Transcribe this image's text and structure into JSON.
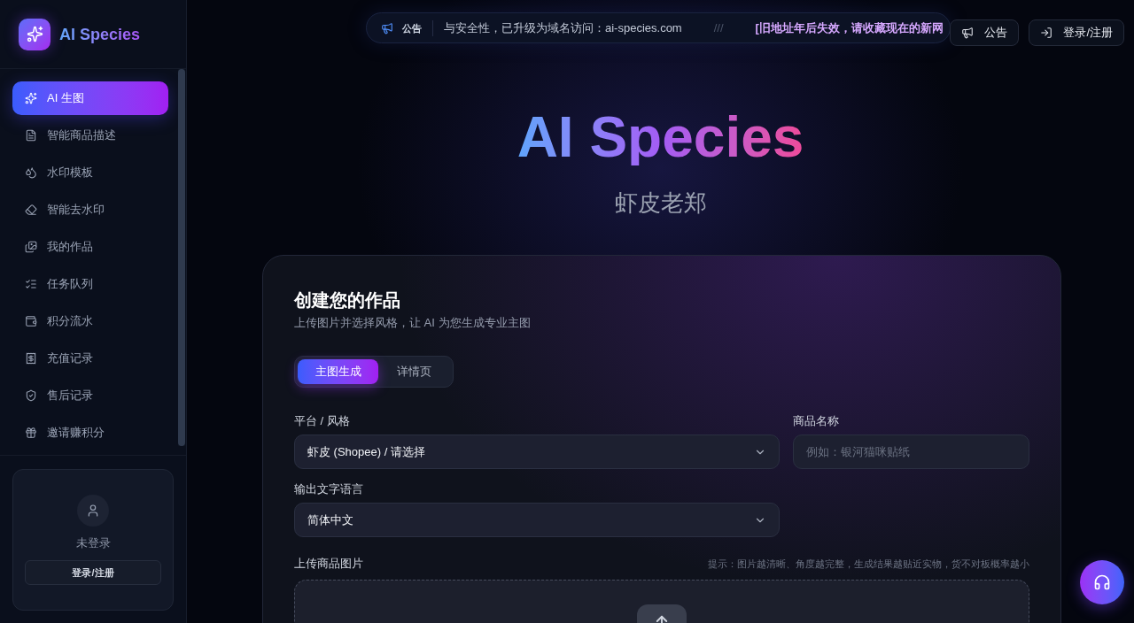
{
  "sidebar": {
    "brand": "AI Species",
    "nav_items": [
      {
        "label": "AI 生图",
        "selected": true
      },
      {
        "label": "智能商品描述",
        "selected": false
      },
      {
        "label": "水印模板",
        "selected": false
      },
      {
        "label": "智能去水印",
        "selected": false
      },
      {
        "label": "我的作品",
        "selected": false
      },
      {
        "label": "任务队列",
        "selected": false
      },
      {
        "label": "积分流水",
        "selected": false
      },
      {
        "label": "充值记录",
        "selected": false
      },
      {
        "label": "售后记录",
        "selected": false
      },
      {
        "label": "邀请赚积分",
        "selected": false
      }
    ],
    "user_card": {
      "status": "未登录",
      "login_button": "登录/注册"
    }
  },
  "top_bar": {
    "announcement": {
      "badge": "公告",
      "messages": [
        {
          "kind": "normal",
          "text": "与安全性，已升级为域名访问：ai-species.com"
        },
        {
          "kind": "separator",
          "text": "///"
        },
        {
          "kind": "highlight",
          "text": "[旧地址年后失效，请收藏现在的新网"
        }
      ]
    },
    "buttons": [
      {
        "kind": "announcement",
        "label": "公告"
      },
      {
        "kind": "login",
        "label": "登录/注册"
      }
    ]
  },
  "hero": {
    "title": "AI Species",
    "subtitle": "虾皮老郑"
  },
  "create_card": {
    "title": "创建您的作品",
    "subtitle": "上传图片并选择风格，让 AI 为您生成专业主图",
    "tabs": [
      {
        "label": "主图生成",
        "selected": true
      },
      {
        "label": "详情页",
        "selected": false
      }
    ],
    "fields": [
      {
        "kind": "select",
        "label": "平台 / 风格",
        "value": "虾皮 (Shopee) / 请选择"
      },
      {
        "kind": "text_input",
        "label": "商品名称",
        "placeholder": "例如：银河猫咪贴纸"
      },
      {
        "kind": "select",
        "label": "输出文字语言",
        "value": "简体中文"
      }
    ],
    "upload": {
      "label": "上传商品图片",
      "hint": "提示：图片越清晰、角度越完整，生成结果越贴近实物，货不对板概率越小"
    }
  }
}
